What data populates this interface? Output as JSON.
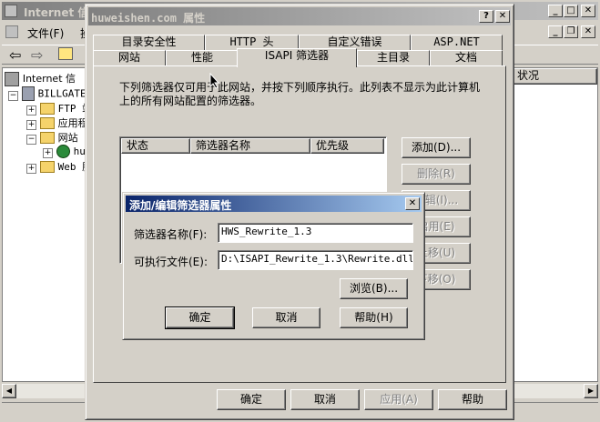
{
  "mmc": {
    "title": "Internet 信",
    "menu": [
      "文件(F)",
      "操"
    ],
    "tree": [
      {
        "label": "Internet 信",
        "indent": 0
      },
      {
        "label": "BILLGATE",
        "indent": 1
      },
      {
        "label": "FTP 站",
        "indent": 2
      },
      {
        "label": "应用程",
        "indent": 2
      },
      {
        "label": "网站",
        "indent": 2
      },
      {
        "label": "hu",
        "indent": 3
      },
      {
        "label": "Web 服",
        "indent": 2
      }
    ],
    "column_status": "状况"
  },
  "props": {
    "title": "huweishen.com 属性",
    "help_btn": "?",
    "close_btn": "✕",
    "tabs_row1": [
      "目录安全性",
      "HTTP 头",
      "自定义错误",
      "ASP.NET"
    ],
    "tabs_row2": [
      "网站",
      "性能",
      "ISAPI 筛选器",
      "主目录",
      "文档"
    ],
    "description": "下列筛选器仅可用于此网站，并按下列顺序执行。此列表不显示为此计算机上的所有网站配置的筛选器。",
    "columns": [
      "状态",
      "筛选器名称",
      "优先级"
    ],
    "buttons": [
      "添加(D)...",
      "删除(R)",
      "编辑(I)...",
      "启用(E)",
      "上移(U)",
      "下移(O)"
    ],
    "bottom_buttons": [
      "确定",
      "取消",
      "应用(A)",
      "帮助"
    ]
  },
  "dialog": {
    "title": "添加/编辑筛选器属性",
    "close_btn": "✕",
    "name_label": "筛选器名称(F):",
    "name_value": "HWS_Rewrite_1.3",
    "exe_label": "可执行文件(E):",
    "exe_value": "D:\\ISAPI_Rewrite_1.3\\Rewrite.dll",
    "browse": "浏览(B)...",
    "ok": "确定",
    "cancel": "取消",
    "help": "帮助(H)"
  }
}
